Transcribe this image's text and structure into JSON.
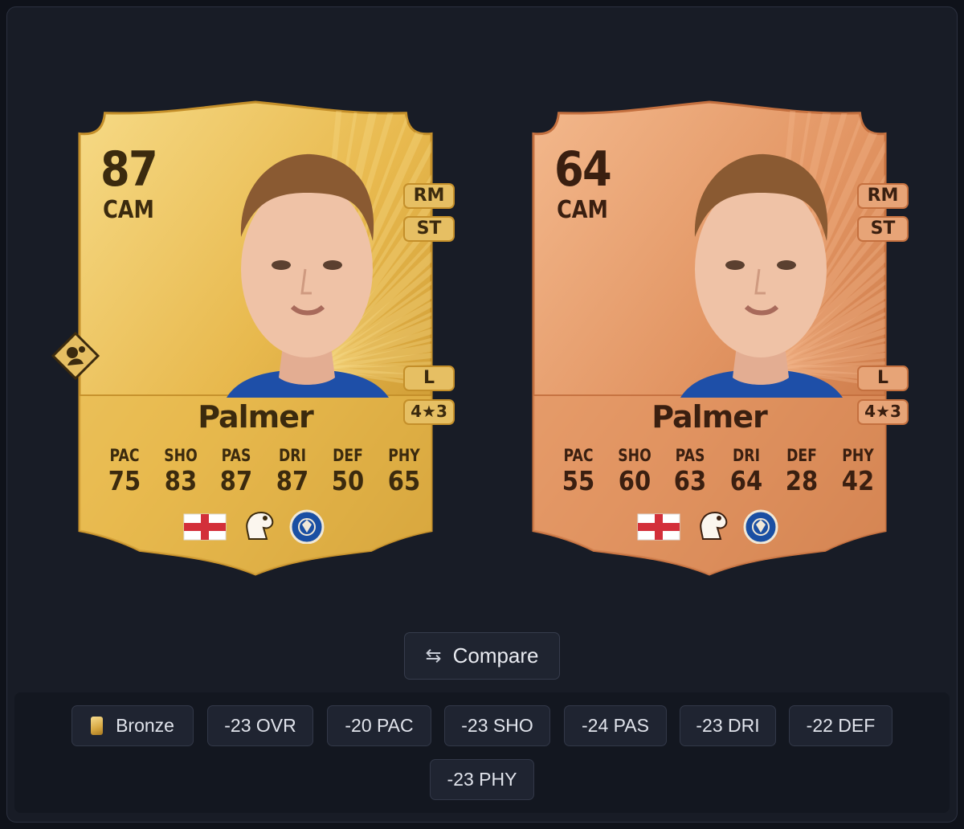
{
  "cards": [
    {
      "tier": "gold",
      "rating": "87",
      "position": "CAM",
      "alt_positions": [
        "RM",
        "ST"
      ],
      "foot": "L",
      "skill_weak": "4★3",
      "name": "Palmer",
      "stat_labels": [
        "PAC",
        "SHO",
        "PAS",
        "DRI",
        "DEF",
        "PHY"
      ],
      "stat_values": [
        "75",
        "83",
        "87",
        "87",
        "50",
        "65"
      ],
      "badges": [
        "england-flag-icon",
        "premier-league-icon",
        "chelsea-crest-icon"
      ],
      "playstyle": "playstyle-plus-icon",
      "colors": {
        "base": "#e8b94e",
        "light": "#f6da86",
        "dark": "#c48f2a",
        "text": "#3b2a0e",
        "chip": "#e6bf63"
      }
    },
    {
      "tier": "bronze",
      "rating": "64",
      "position": "CAM",
      "alt_positions": [
        "RM",
        "ST"
      ],
      "foot": "L",
      "skill_weak": "4★3",
      "name": "Palmer",
      "stat_labels": [
        "PAC",
        "SHO",
        "PAS",
        "DRI",
        "DEF",
        "PHY"
      ],
      "stat_values": [
        "55",
        "60",
        "63",
        "64",
        "28",
        "42"
      ],
      "badges": [
        "england-flag-icon",
        "premier-league-icon",
        "chelsea-crest-icon"
      ],
      "colors": {
        "base": "#e29563",
        "light": "#f3b88c",
        "dark": "#c4703f",
        "text": "#3a1f10",
        "chip": "#e7a477"
      }
    }
  ],
  "compare_button": {
    "label": "Compare",
    "icon": "swap-arrows-icon"
  },
  "differences": [
    {
      "label": "Bronze",
      "icon": "bronze-card-icon"
    },
    {
      "label": "-23 OVR"
    },
    {
      "label": "-20 PAC"
    },
    {
      "label": "-23 SHO"
    },
    {
      "label": "-24 PAS"
    },
    {
      "label": "-23 DRI"
    },
    {
      "label": "-22 DEF"
    },
    {
      "label": "-23 PHY"
    }
  ],
  "colors": {
    "page_bg": "#0f121a",
    "panel_bg": "#181c26",
    "pill_bg": "#1f2431"
  }
}
